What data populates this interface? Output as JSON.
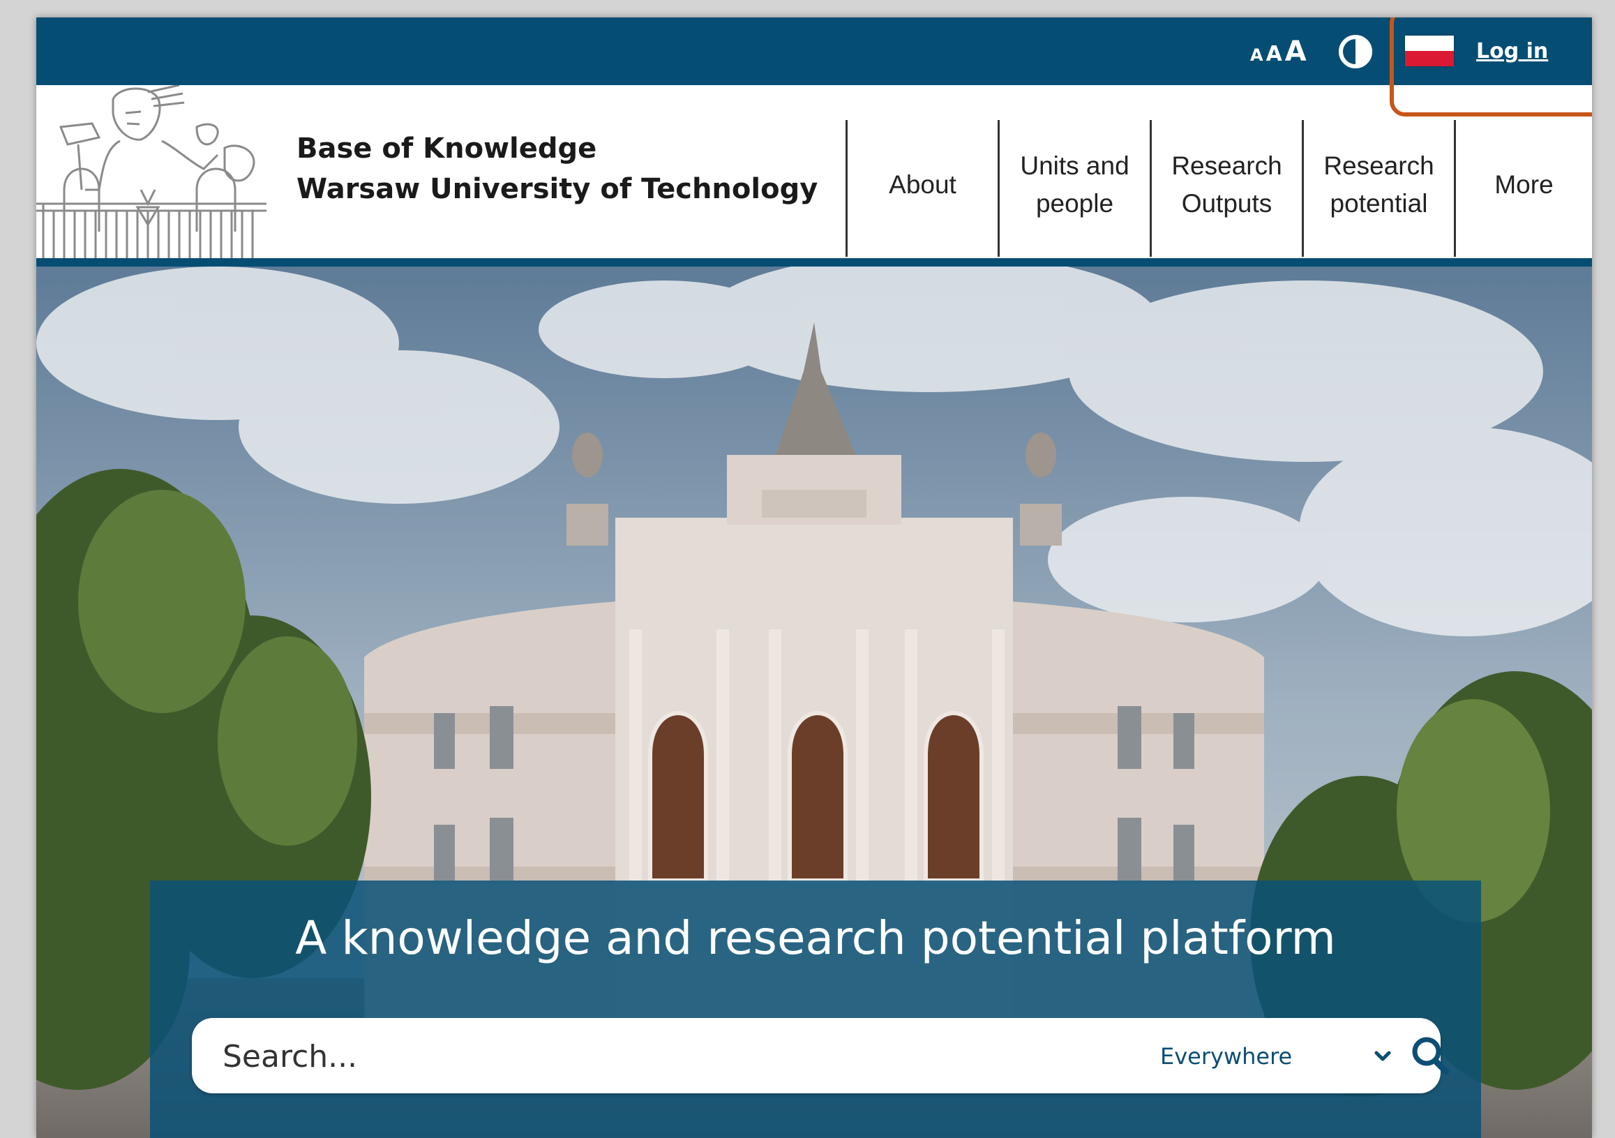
{
  "topbar": {
    "font_size_small": "A",
    "font_size_medium": "A",
    "font_size_large": "A",
    "contrast_icon": "contrast-icon",
    "language_flag": "poland-flag",
    "login_label": "Log in"
  },
  "header": {
    "title_line1": "Base of Knowledge",
    "title_line2": "Warsaw University of Technology",
    "nav": [
      {
        "line1": "About",
        "line2": ""
      },
      {
        "line1": "Units and",
        "line2": "people"
      },
      {
        "line1": "Research",
        "line2": "Outputs"
      },
      {
        "line1": "Research",
        "line2": "potential"
      },
      {
        "line1": "More",
        "line2": ""
      }
    ]
  },
  "hero": {
    "tagline": "A knowledge and research potential platform",
    "search": {
      "placeholder": "Search...",
      "scope_value": "Everywhere",
      "chevron_icon": "chevron-down-icon",
      "search_icon": "search-icon"
    }
  },
  "colors": {
    "brand_navy": "#054d73",
    "highlight_orange": "#c8561a",
    "flag_red": "#dc1932"
  }
}
